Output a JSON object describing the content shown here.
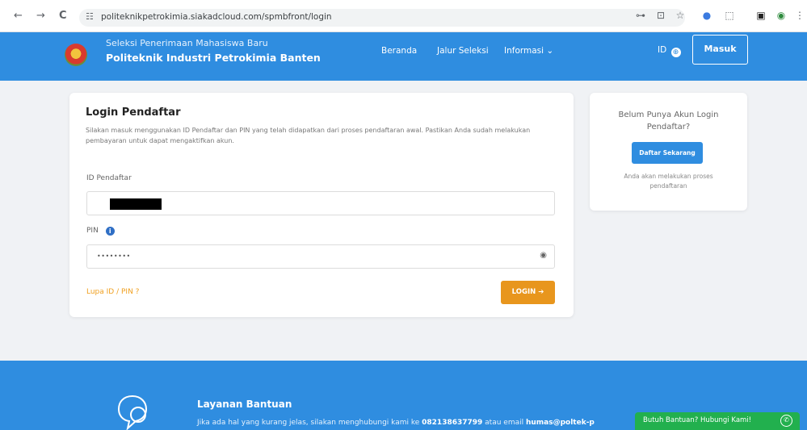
{
  "browser": {
    "url": "politeknikpetrokimia.siakadcloud.com/spmbfront/login",
    "back_glyph": "←",
    "forward_glyph": "→",
    "reload_glyph": "C",
    "site_info_glyph": "☷",
    "icons": [
      "password-key-icon",
      "translate-icon",
      "bookmark-star-icon",
      "extension-blue-icon",
      "extensions-puzzle-icon",
      "sidebar-icon",
      "profile-icon",
      "menu-icon"
    ]
  },
  "header": {
    "brand_subtitle": "Seleksi Penerimaan Mahasiswa Baru",
    "brand_title": "Politeknik Industri Petrokimia Banten",
    "nav": [
      "Beranda",
      "Jalur Seleksi",
      "Informasi ⌄"
    ],
    "lang_label": "ID",
    "login_button": "Masuk"
  },
  "login": {
    "title": "Login Pendaftar",
    "description": "Silakan masuk menggunakan ID Pendaftar dan PIN yang telah didapatkan dari proses pendaftaran awal. Pastikan Anda sudah melakukan pembayaran untuk dapat mengaktifkan akun.",
    "id_label": "ID Pendaftar",
    "pin_label": "PIN",
    "pin_value": "••••••••",
    "forgot_link": "Lupa ID / PIN ?",
    "submit_button": "LOGIN ➔"
  },
  "register": {
    "question": "Belum Punya Akun Login Pendaftar?",
    "button": "Daftar Sekarang",
    "note": "Anda akan melakukan proses pendaftaran"
  },
  "footer": {
    "help_title": "Layanan Bantuan",
    "help_text_prefix": "Jika ada hal yang kurang jelas, silakan menghubungi kami ke ",
    "phone": "082138637799",
    "help_text_mid": " atau email ",
    "email": "humas@poltek-p"
  },
  "whatsapp": {
    "label": "Butuh Bantuan? Hubungi Kami!"
  },
  "colors": {
    "primary": "#2f8de0",
    "accent_orange": "#e8961d",
    "whatsapp": "#22b04e"
  }
}
